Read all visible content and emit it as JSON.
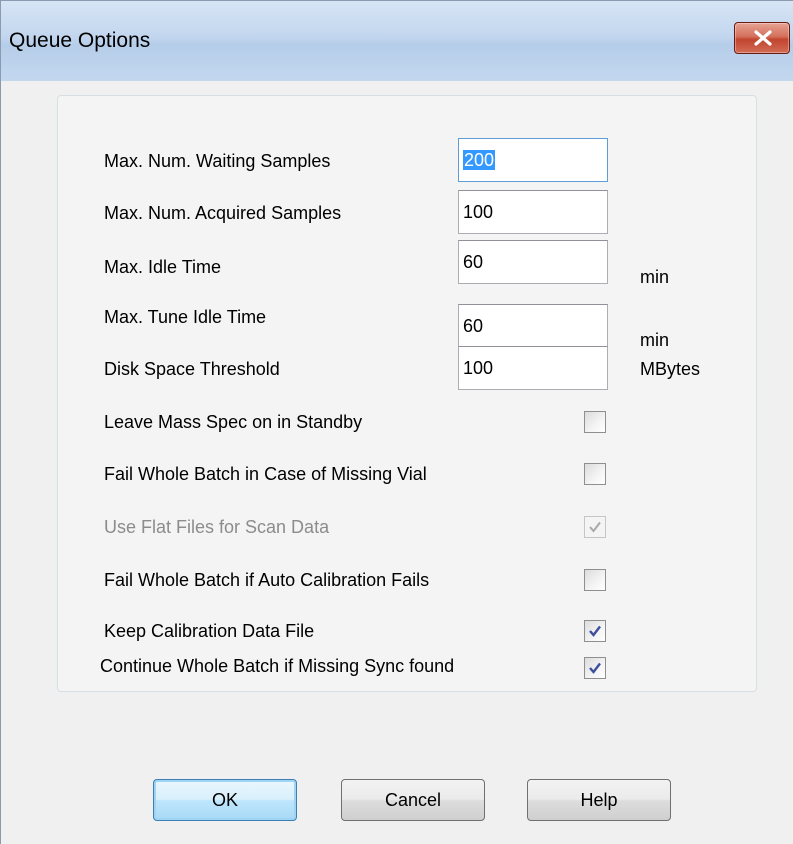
{
  "window": {
    "title": "Queue Options"
  },
  "icons": {
    "close": "close-icon",
    "check": "checkmark-icon"
  },
  "colors": {
    "titlebar": "#c2d6ee",
    "close_button": "#c2452f",
    "selection": "#3399ff",
    "focus_border": "#5d9ed6",
    "disabled_text": "#8c8c8c"
  },
  "fields": [
    {
      "label": "Max. Num. Waiting Samples",
      "value": "200",
      "unit": "",
      "focused": true,
      "selected": true
    },
    {
      "label": "Max. Num. Acquired Samples",
      "value": "100",
      "unit": ""
    },
    {
      "label": "Max. Idle Time",
      "value": "60",
      "unit": "min"
    },
    {
      "label": "Max. Tune Idle Time",
      "value": "60",
      "unit": "min"
    },
    {
      "label": "Disk Space Threshold",
      "value": "100",
      "unit": "MBytes"
    }
  ],
  "checkboxes": [
    {
      "label": "Leave Mass Spec on in Standby",
      "checked": false,
      "enabled": true
    },
    {
      "label": "Fail Whole Batch in Case of Missing Vial",
      "checked": false,
      "enabled": true
    },
    {
      "label": "Use Flat Files for Scan Data",
      "checked": true,
      "enabled": false
    },
    {
      "label": "Fail Whole Batch if Auto Calibration Fails",
      "checked": false,
      "enabled": true
    },
    {
      "label": "Keep Calibration Data File",
      "checked": true,
      "enabled": true
    },
    {
      "label": "Continue Whole Batch if Missing Sync found",
      "checked": true,
      "enabled": true
    }
  ],
  "buttons": {
    "ok": "OK",
    "cancel": "Cancel",
    "help": "Help"
  }
}
